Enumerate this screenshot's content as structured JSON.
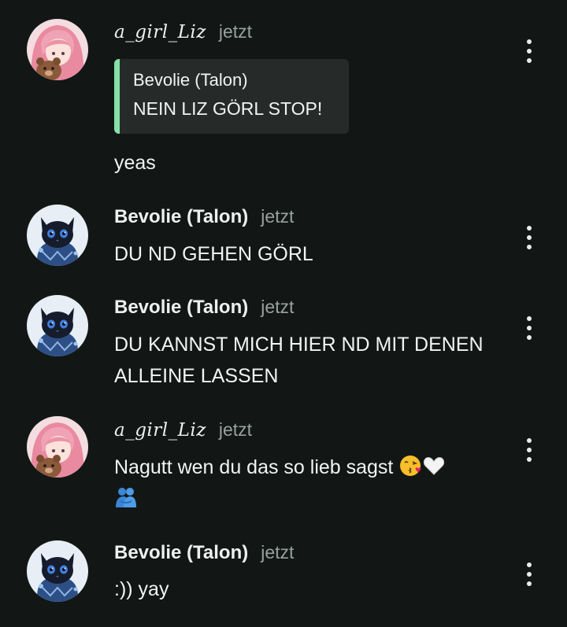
{
  "messages": [
    {
      "user": "a_girl_Liz",
      "time": "jetzt",
      "avatar": "pink-hair-girl-with-bear",
      "quote": {
        "author": "Bevolie (Talon)",
        "text": "NEIN LIZ GÖRL STOP!"
      },
      "text": "yeas"
    },
    {
      "user": "Bevolie (Talon)",
      "time": "jetzt",
      "avatar": "blue-black-cat",
      "text": "DU ND GEHEN GÖRL"
    },
    {
      "user": "Bevolie (Talon)",
      "time": "jetzt",
      "avatar": "blue-black-cat",
      "text_line1": "DU KANNST MICH HIER ND MIT DENEN",
      "text_line2": "ALLEINE LASSEN"
    },
    {
      "user": "a_girl_Liz",
      "time": "jetzt",
      "avatar": "pink-hair-girl-with-bear",
      "text": "Nagutt wen du das so lieb sagst",
      "emojis": [
        "face-blowing-a-kiss",
        "white-heart",
        "people-hugging"
      ]
    },
    {
      "user": "Bevolie (Talon)",
      "time": "jetzt",
      "avatar": "blue-black-cat",
      "text": ":)) yay"
    }
  ],
  "icons": {
    "more": "more-vertical-icon"
  },
  "colors": {
    "background": "#121716",
    "quote_bg": "#262b2a",
    "quote_accent": "#86e0a9",
    "timestamp": "#9aa09e"
  }
}
